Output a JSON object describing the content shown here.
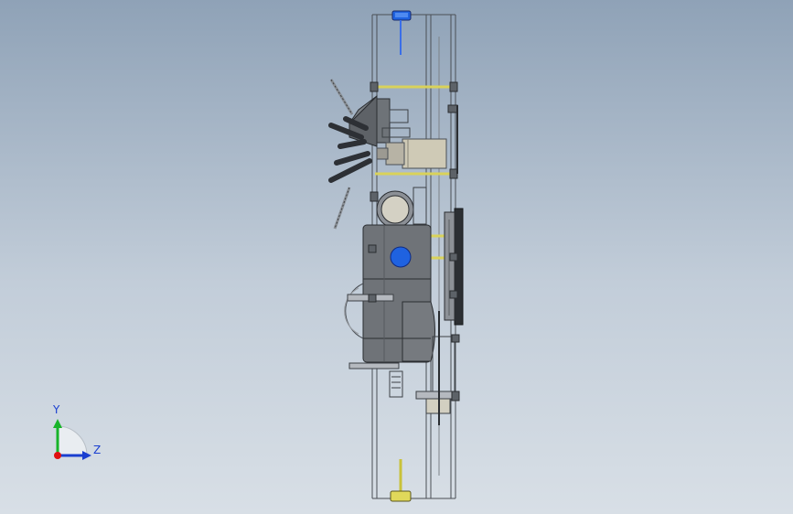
{
  "viewport": {
    "background_top": "#8fa2b7",
    "background_bottom": "#d8dfe6"
  },
  "triad": {
    "y_label": "Y",
    "z_label": "Z",
    "y_color": "#18b42a",
    "z_color": "#1a3fd0",
    "x_color": "#e01010"
  },
  "model": {
    "body_color": "#6f7378",
    "rail_color": "#4a4f55",
    "rod_color": "#d9d25a",
    "knob_color": "#1f62e0"
  }
}
